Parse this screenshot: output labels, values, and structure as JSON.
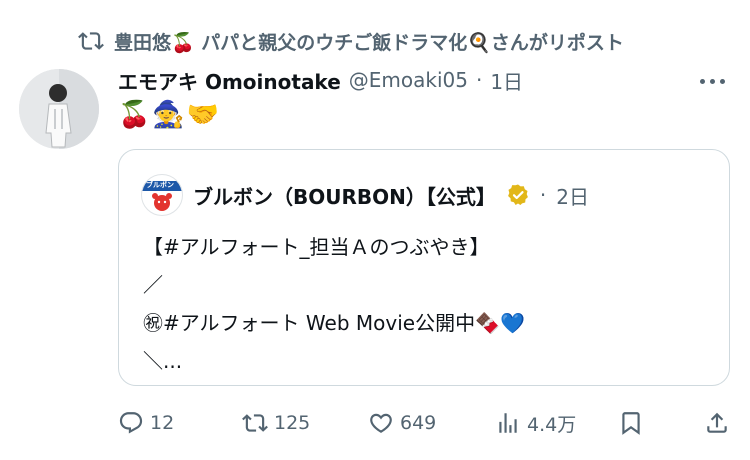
{
  "repost": {
    "text": "豊田悠🍒 パパと親父のウチご飯ドラマ化🍳さんがリポスト"
  },
  "post": {
    "author_name": "エモアキ Omoinotake",
    "handle": "@Emoaki05",
    "separator": "·",
    "time": "1日",
    "text": "🍒🧙🤝"
  },
  "quote": {
    "author_name": "ブルボン（BOURBON）【公式】",
    "logo_text": "ブルボン",
    "separator": "·",
    "time": "2日",
    "lines": [
      "【#アルフォート_担当Ａのつぶやき】",
      "／",
      "㊗#アルフォート Web Movie公開中🍫💙",
      "＼..."
    ]
  },
  "actions": {
    "replies": "12",
    "reposts": "125",
    "likes": "649",
    "views": "4.4万"
  },
  "colors": {
    "text_primary": "#0f1419",
    "text_secondary": "#536471",
    "border": "#cfd9de",
    "verified_gold": "#e2b719"
  }
}
